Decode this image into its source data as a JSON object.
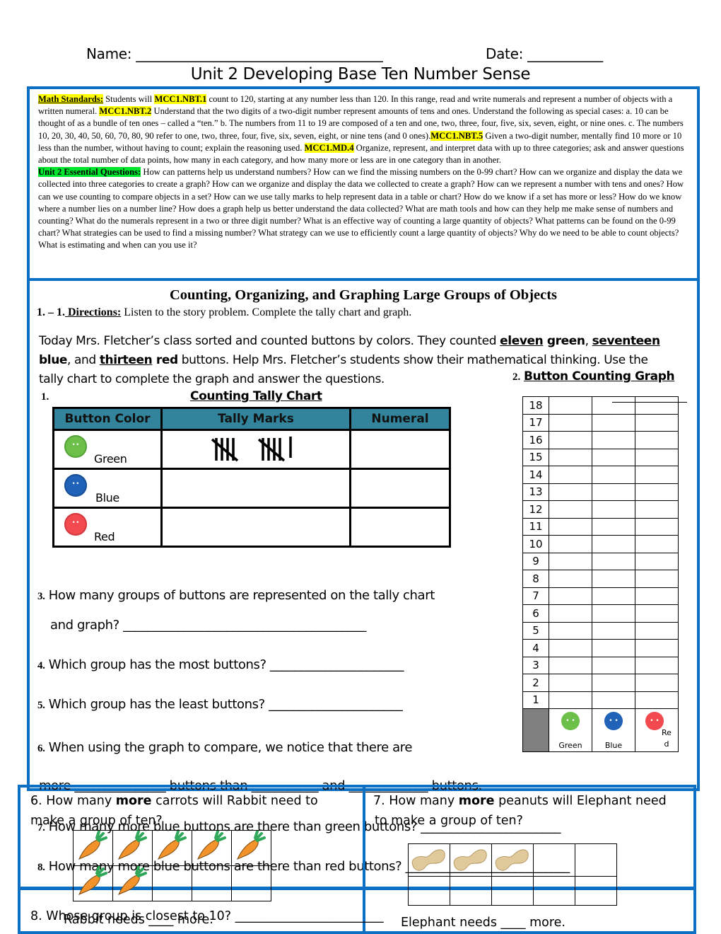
{
  "header": {
    "name_label": "Name: ____________________________________",
    "date_label": "Date: ___________",
    "title": "Unit 2 Developing Base Ten Number Sense"
  },
  "standards": {
    "label": "Math Standards:",
    "t1": " Students will ",
    "c1": "MCC1.NBT.1",
    "t2": " count to 120, starting at any number less than 120. In this range, read and write numerals and represent a number of objects with a written numeral. ",
    "c2": "MCC1.NBT.2",
    "t3": " Understand that the two digits of a two-digit number represent amounts of tens and ones. Understand the following as special cases: a. 10 can be thought of as a bundle of ten ones – called a “ten.” b. The numbers from 11 to 19 are composed of a ten and one, two, three, four, five, six, seven, eight, or nine ones. c. The numbers 10, 20, 30, 40, 50, 60, 70, 80, 90 refer to one, two, three, four, five, six, seven, eight, or nine tens (and 0 ones).",
    "c3": "MCC1.NBT.5",
    "t4": " Given a two-digit number, mentally find 10 more or 10 less than the number, without having to count; explain the reasoning used. ",
    "c4": "MCC1.MD.4",
    "t5": " Organize, represent, and interpret data with up to three categories; ask and answer questions about the total number of data points, how many in each category, and how many more or less are in one category than in another.",
    "eq_label": "Unit 2 Essential Questions:",
    "eq_text": "  How can patterns help us understand numbers? How can we find the missing numbers on the 0-99 chart? How can we organize and display the data we collected into three categories to create a graph? How can we organize and display the data we collected to create a graph? How can we represent a number with tens and ones? How can we use counting to compare objects in a set? How can we use tally marks to help represent data in a table or chart? How do we know if a set has more or less? How do we know where a number lies on a number line? How does a graph help us better understand the data collected? What are math tools and how can they help me make sense of numbers and counting? What do the numerals represent in a two or three digit number? What is an effective way of counting a large quantity of objects? What patterns can be found on the 0-99 chart? What strategies can be used to find a missing number? What strategy can we use to efficiently count a large quantity of objects?  Why do we need to be able to count objects? What is estimating and when can you use it?"
  },
  "lesson": {
    "title": "Counting, Organizing, and Graphing Large Groups of Objects",
    "dir_num": "1.  – 1.",
    "dir_label": " Directions:",
    "dir_text": " Listen to the story problem. Complete the tally chart and graph.",
    "story": {
      "p1": "Today Mrs. Fletcher’s class sorted and counted buttons by colors. They counted ",
      "w1": "eleven",
      "c1": " green",
      "p2": ", ",
      "w2": "seventeen",
      "c2": "blue",
      "p3": ", and ",
      "w3": "thirteen",
      "c3": " red",
      "p4": " buttons.  Help Mrs. Fletcher’s students show their mathematical thinking. Use the tally chart to complete the graph and answer the questions."
    }
  },
  "tally_chart": {
    "num": "1.",
    "title": "Counting Tally Chart",
    "headers": [
      "Button Color",
      "Tally Marks",
      "Numeral"
    ],
    "rows": [
      {
        "color": "Green",
        "hex": "#6cc04a",
        "tally": 11,
        "numeral": ""
      },
      {
        "color": "Blue",
        "hex": "#1f62b8",
        "tally": 0,
        "numeral": ""
      },
      {
        "color": "Red",
        "hex": "#f24a4f",
        "tally": 0,
        "numeral": ""
      }
    ]
  },
  "graph": {
    "num": "2.",
    "title": "Button Counting Graph",
    "y_labels": [
      "18",
      "17",
      "16",
      "15",
      "14",
      "13",
      "12",
      "11",
      "10",
      "9",
      "8",
      "7",
      "6",
      "5",
      "4",
      "3",
      "2",
      "1"
    ],
    "categories": [
      {
        "label": "Green",
        "hex": "#6cc04a"
      },
      {
        "label": "Blue",
        "hex": "#1f62b8"
      },
      {
        "label": "Re d",
        "hex": "#f24a4f"
      }
    ]
  },
  "questions": {
    "q3_num": "3.",
    "q3a": " How many groups of buttons are represented on the tally chart",
    "q3b": "and graph?  ________________________________________",
    "q4_num": "4.",
    "q4": " Which group has the most buttons? ______________________",
    "q5_num": "5.",
    "q5": " Which group has the least buttons? ______________________",
    "q6_num": "6.",
    "q6a": " When using the graph to compare, we notice that there are",
    "q6b": "more _______________ buttons than ___________ and _____________ buttons.",
    "q7_num": "7.",
    "q7": " How many more blue buttons are there than green buttons? _______________________",
    "q8_num": "8.",
    "q8": " How many more blue buttons are there than red buttons? ___________________________"
  },
  "overlay": {
    "rabbit_q1": "6. How many ",
    "rabbit_bold": "more",
    "rabbit_q2": " carrots will Rabbit need to",
    "rabbit_q3": "make a group of ten?",
    "rabbit_items": 7,
    "rabbit_answer": "Rabbit needs ____ more.",
    "elephant_q1": "7. How many ",
    "elephant_bold": "more",
    "elephant_q2": " peanuts will Elephant need",
    "elephant_q3": "to make a group of ten?",
    "elephant_items": 3,
    "elephant_answer": "Elephant needs ____ more.",
    "closest_q": "8. Whose group is closest to 10? ________________________"
  }
}
